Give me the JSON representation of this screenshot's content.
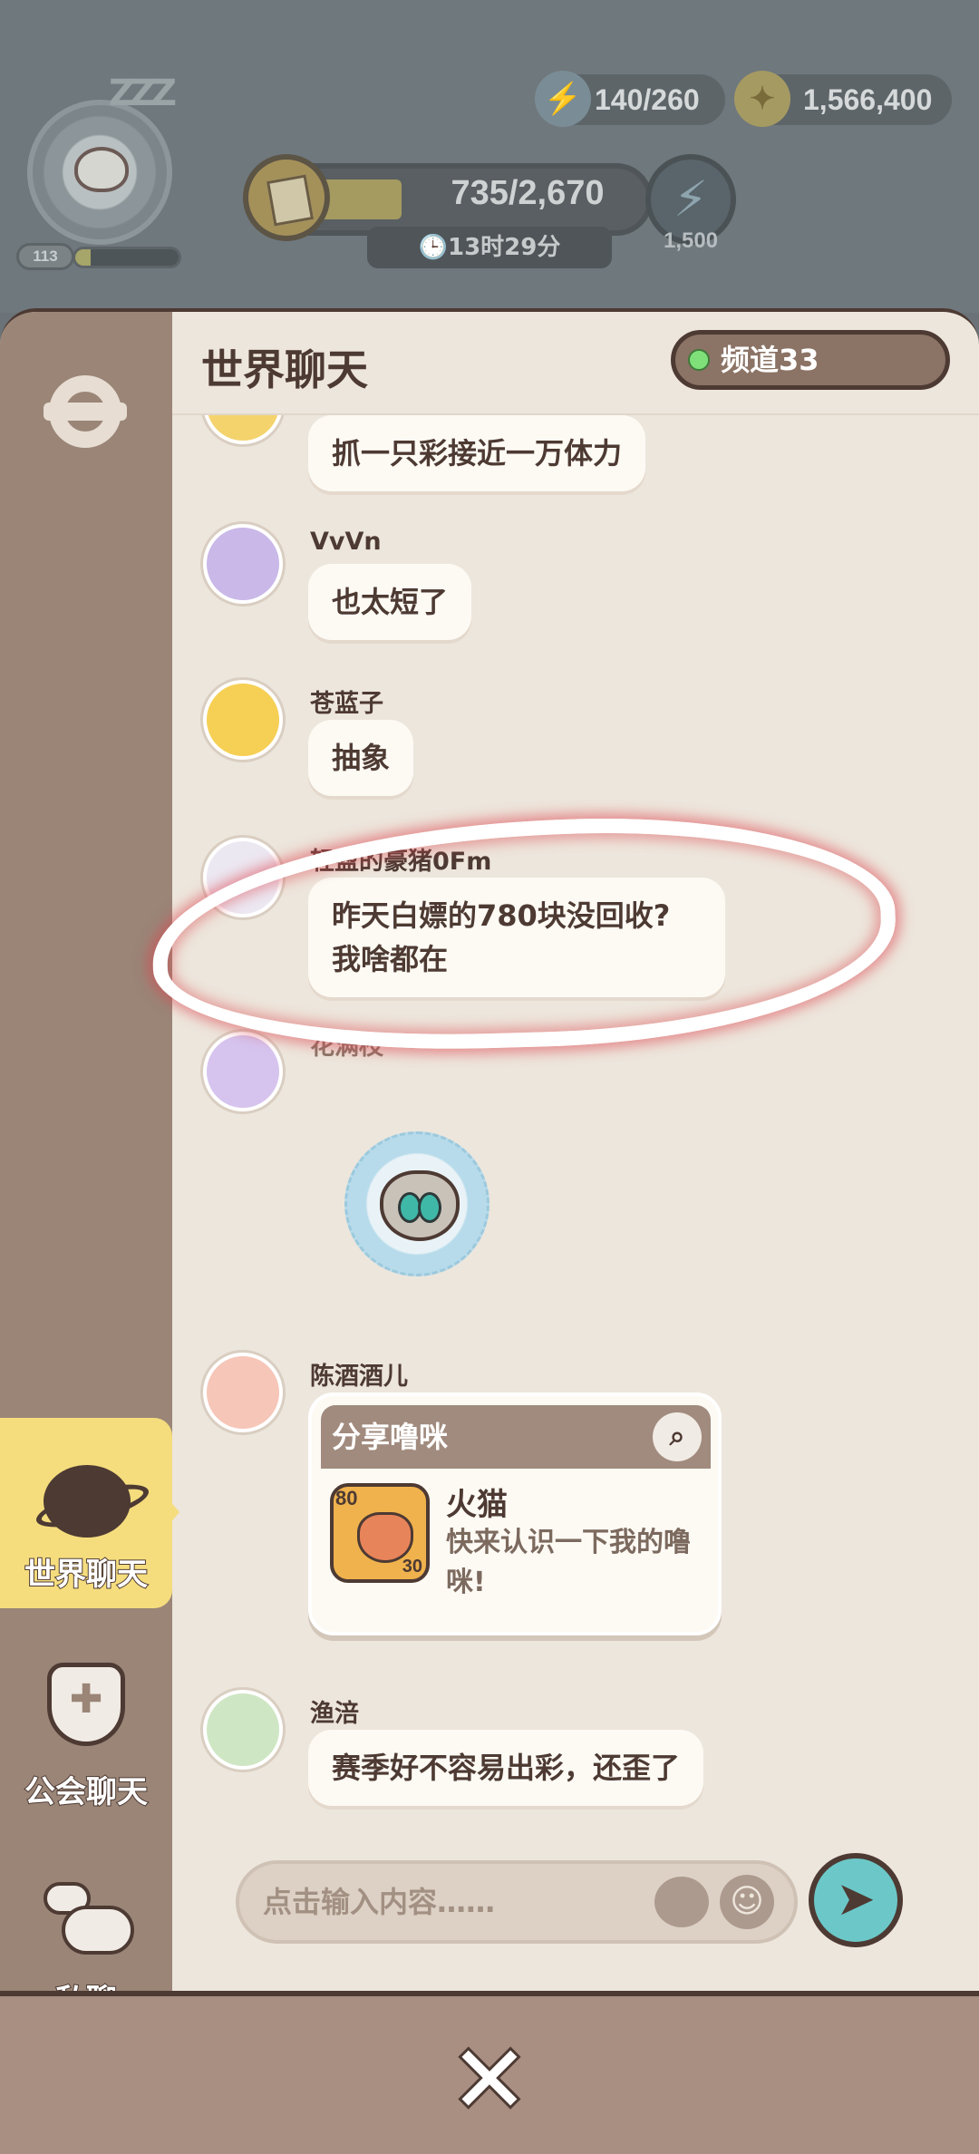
{
  "hud": {
    "level": "113",
    "energy": "140/260",
    "coins": "1,566,400",
    "quest_progress": "735/2,670",
    "quest_fraction": 0.275,
    "timer": "🕒13时29分",
    "bolt_reward": "1,500",
    "xp_fraction": 0.15
  },
  "header": {
    "title": "世界聊天",
    "channel": "频道33"
  },
  "sidebar": {
    "world": "世界聊天",
    "guild": "公会聊天",
    "private": "私聊"
  },
  "messages": [
    {
      "name": "",
      "text": "抓一只彩接近一万体力"
    },
    {
      "name": "VvVn",
      "text": "也太短了"
    },
    {
      "name": "苍蓝子",
      "text": "抽象"
    },
    {
      "name": "轻盈的豪猪0Fm",
      "text": "昨天白嫖的780块没回收?\n我啥都在"
    },
    {
      "name": "花满枝",
      "text": ""
    },
    {
      "name": "陈酒酒儿",
      "text": ""
    },
    {
      "name": "渔涪",
      "text": "赛季好不容易出彩，还歪了"
    }
  ],
  "share_card": {
    "title": "分享噜咪",
    "pet_level": "80",
    "pet_sub": "30",
    "pet_name": "火猫",
    "pet_desc": "快来认识一下我的噜咪!"
  },
  "input": {
    "placeholder": "点击输入内容……"
  },
  "icons": {
    "energy": "bolt-icon",
    "coin": "coin-icon",
    "settings": "gear-icon",
    "search": "magnifier-icon",
    "send": "paper-plane-icon",
    "close": "close-icon"
  }
}
